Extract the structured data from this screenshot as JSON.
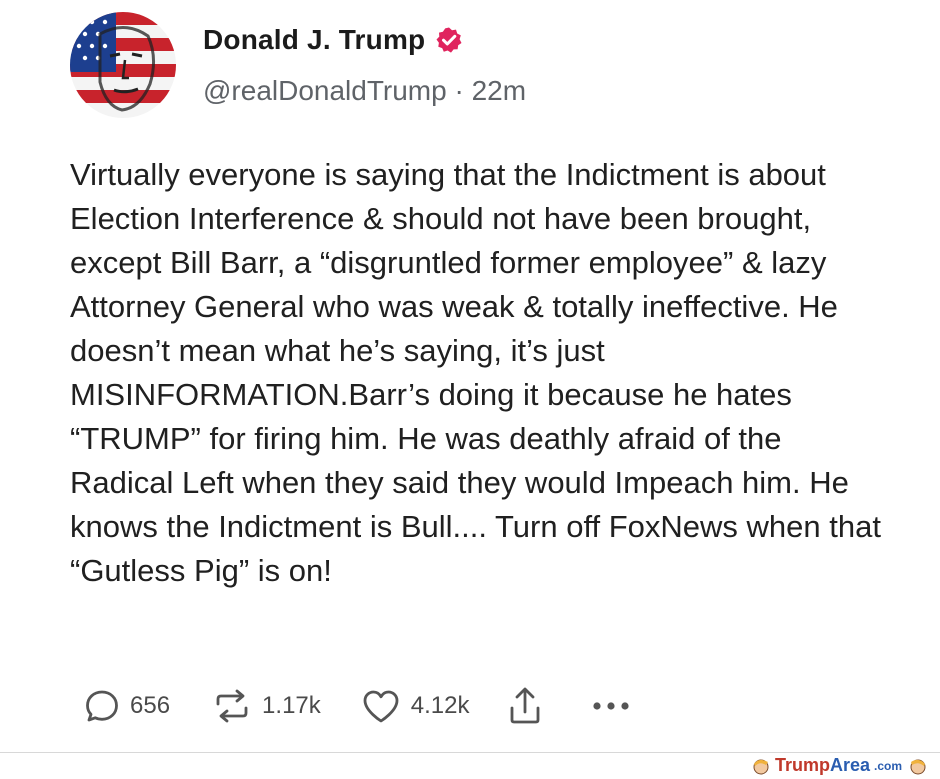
{
  "post": {
    "author_name": "Donald J. Trump",
    "handle": "@realDonaldTrump",
    "separator": "·",
    "time_ago": "22m",
    "text": "Virtually everyone is saying that the Indictment is about Election Interference & should not have been brought, except Bill Barr, a “disgruntled former employee” & lazy Attorney General who was weak & totally ineffective. He doesn’t mean what he’s saying, it’s just MISINFORMATION.Barr’s doing it because he hates “TRUMP” for firing him. He was deathly afraid of the Radical Left when they said they would Impeach him. He knows the Indictment is Bull.... Turn off FoxNews when that “Gutless Pig” is on!",
    "avatar_icon": "flag-face-avatar",
    "verified_icon": "verified-badge-icon"
  },
  "actions": {
    "replies": {
      "icon": "comment-icon",
      "count": "656"
    },
    "reposts": {
      "icon": "repost-icon",
      "count": "1.17k"
    },
    "likes": {
      "icon": "heart-icon",
      "count": "4.12k"
    },
    "share": {
      "icon": "share-icon"
    },
    "more": {
      "icon": "more-icon"
    }
  },
  "watermark": {
    "brand_first": "Trump",
    "brand_second": "Area",
    "domain": ".com"
  },
  "colors": {
    "verified": "#e0245e",
    "text": "#202020",
    "muted": "#5f6368"
  }
}
